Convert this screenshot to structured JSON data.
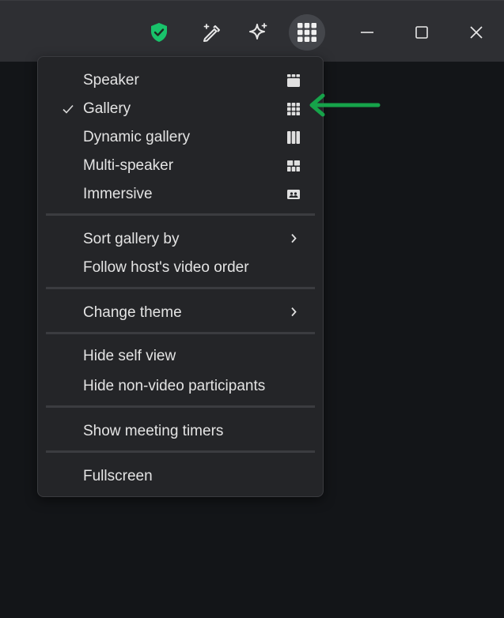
{
  "toolbar": {
    "icons": [
      "shield-check-icon",
      "magic-pen-icon",
      "sparkle-icon",
      "grid-view-icon"
    ],
    "shield_color": "#19c36b"
  },
  "window_controls": [
    "minimize-icon",
    "maximize-icon",
    "close-icon"
  ],
  "menu": {
    "layouts": [
      {
        "label": "Speaker",
        "icon": "speaker-layout-icon",
        "checked": false
      },
      {
        "label": "Gallery",
        "icon": "gallery-layout-icon",
        "checked": true
      },
      {
        "label": "Dynamic gallery",
        "icon": "dynamic-gallery-icon",
        "checked": false
      },
      {
        "label": "Multi-speaker",
        "icon": "multi-speaker-icon",
        "checked": false
      },
      {
        "label": "Immersive",
        "icon": "immersive-icon",
        "checked": false
      }
    ],
    "sort_gallery_by": "Sort gallery by",
    "follow_host_order": "Follow host's video order",
    "change_theme": "Change theme",
    "hide_self_view": "Hide self view",
    "hide_non_video": "Hide non-video participants",
    "show_timers": "Show meeting timers",
    "fullscreen": "Fullscreen"
  },
  "annotation": {
    "arrow_color": "#16a34a"
  }
}
